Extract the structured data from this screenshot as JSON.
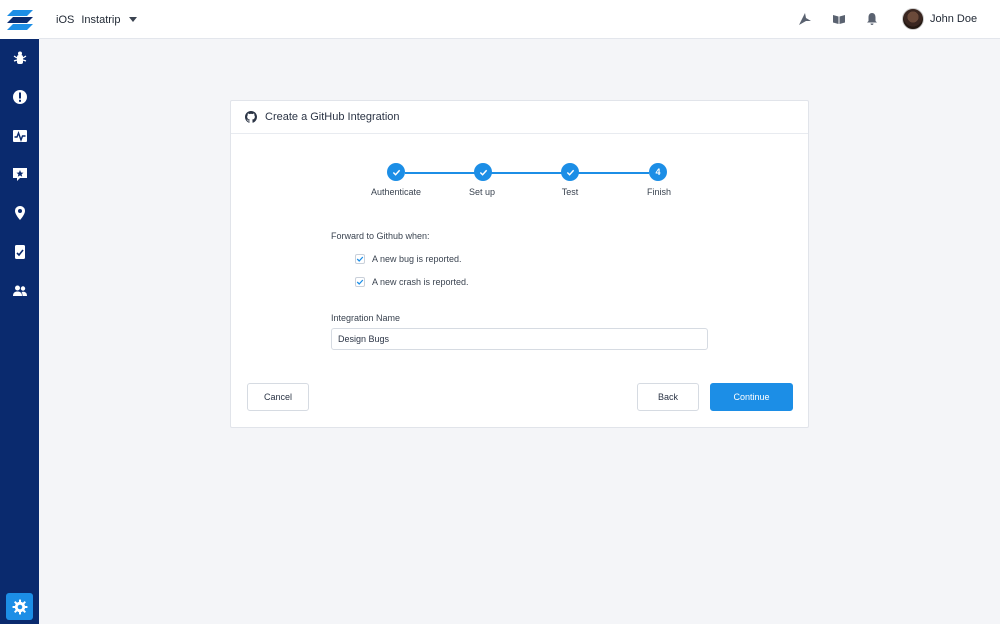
{
  "topbar": {
    "platform": "iOS",
    "app_name": "Instatrip",
    "icons": [
      "announcement-icon",
      "book-icon",
      "bell-icon"
    ],
    "user_name": "John Doe"
  },
  "sidebar": {
    "items": [
      "bug-icon",
      "crash-icon",
      "apm-icon",
      "feature-request-icon",
      "location-icon",
      "app-rating-icon",
      "users-icon"
    ],
    "settings_icon": "gear-icon"
  },
  "card": {
    "title": "Create a GitHub Integration",
    "steps": [
      {
        "label": "Authenticate",
        "state": "done"
      },
      {
        "label": "Set up",
        "state": "done"
      },
      {
        "label": "Test",
        "state": "done"
      },
      {
        "label": "Finish",
        "state": "current",
        "number": "4"
      }
    ],
    "forward_label": "Forward to Github when:",
    "options": [
      {
        "label": "A new bug is reported.",
        "checked": true
      },
      {
        "label": "A new crash is reported.",
        "checked": true
      }
    ],
    "integration_name_label": "Integration Name",
    "integration_name_value": "Design Bugs",
    "cancel_label": "Cancel",
    "back_label": "Back",
    "continue_label": "Continue"
  },
  "colors": {
    "sidebar_bg": "#0a2a6e",
    "accent": "#1c8ee6",
    "page_bg": "#f4f5f8"
  }
}
